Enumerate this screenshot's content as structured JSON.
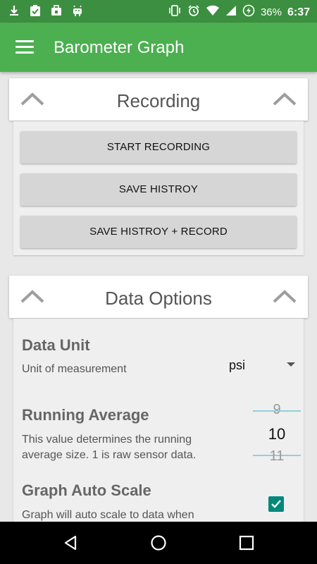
{
  "status_bar": {
    "icons_left": [
      "download-icon",
      "clipboard-check-icon",
      "briefcase-icon",
      "android-icon"
    ],
    "icons_right": [
      "vibrate-icon",
      "alarm-icon",
      "wifi-icon",
      "signal-icon",
      "battery-saver-icon"
    ],
    "battery": "36%",
    "time": "6:37"
  },
  "app_bar": {
    "title": "Barometer Graph"
  },
  "recording": {
    "title": "Recording",
    "buttons": [
      "START RECORDING",
      "SAVE HISTROY",
      "SAVE HISTROY + RECORD"
    ]
  },
  "data_options": {
    "title": "Data Options",
    "data_unit": {
      "title": "Data Unit",
      "subtitle": "Unit of measurement",
      "selected": "psi"
    },
    "running_average": {
      "title": "Running Average",
      "subtitle_line1": "This value determines the running",
      "subtitle_line2": "average size. 1 is raw sensor data.",
      "prev": "9",
      "current": "10",
      "next": "11"
    },
    "graph_auto_scale": {
      "title": "Graph Auto Scale",
      "subtitle": "Graph will auto scale to data when",
      "checked": true
    }
  },
  "colors": {
    "status_bar": "#3c8f40",
    "app_bar": "#4caf50",
    "checkbox": "#00897b",
    "picker_line": "#8fd0de"
  }
}
